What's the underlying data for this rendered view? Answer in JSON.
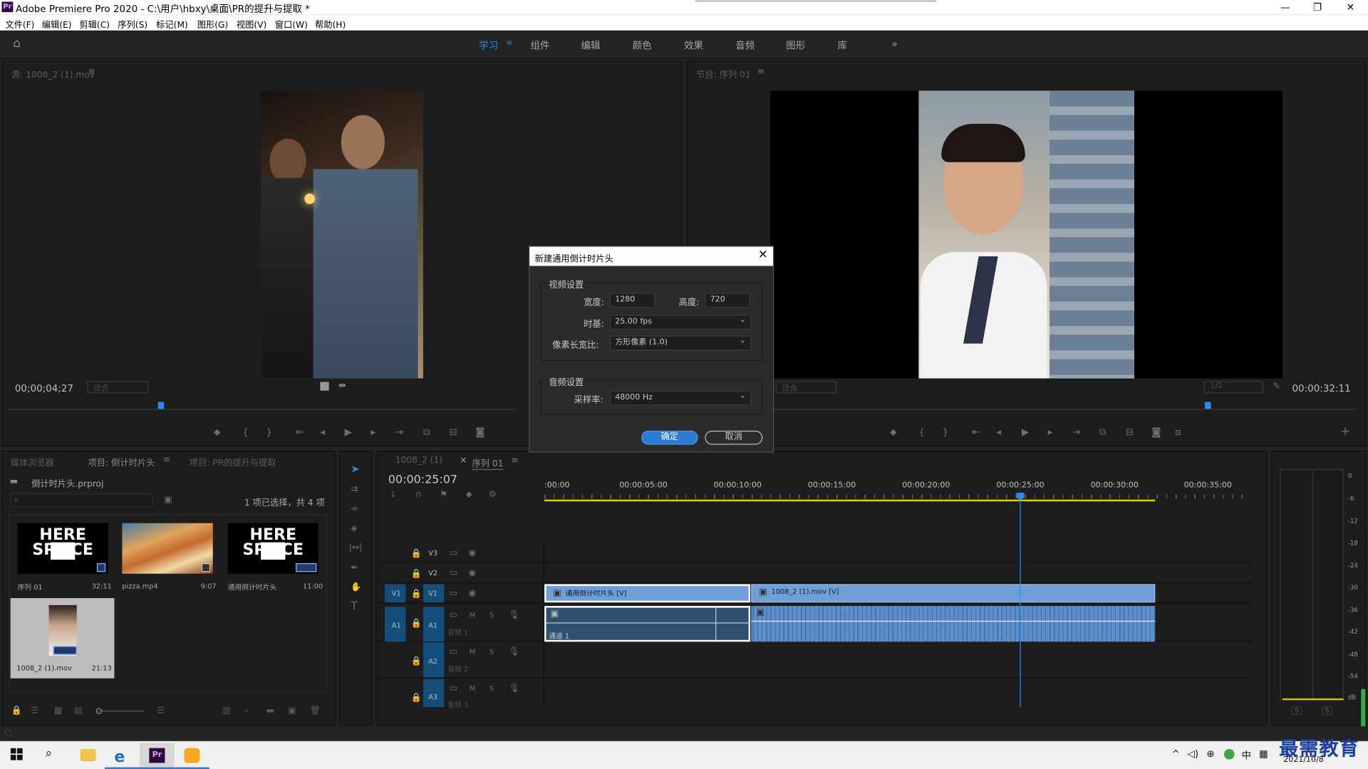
{
  "window": {
    "title": "Adobe Premiere Pro 2020 - C:\\用户\\hbxy\\桌面\\PR的提升与提取 *",
    "logo": "Pr"
  },
  "menu": [
    "文件(F)",
    "编辑(E)",
    "剪辑(C)",
    "序列(S)",
    "标记(M)",
    "图形(G)",
    "视图(V)",
    "窗口(W)",
    "帮助(H)"
  ],
  "workspaces": [
    "学习",
    "组件",
    "编辑",
    "颜色",
    "效果",
    "音频",
    "图形",
    "库"
  ],
  "source": {
    "title": "源: 1008_2 (1).mov",
    "timecode": "00;00;04;27",
    "fit": "适合"
  },
  "program": {
    "title": "节目: 序列 01",
    "timecode": "00:00:32:11",
    "fit": "适合",
    "scale": "1/2"
  },
  "dialog": {
    "title": "新建通用倒计时片头",
    "video_group": "视频设置",
    "width_label": "宽度:",
    "width_value": "1280",
    "height_label": "高度:",
    "height_value": "720",
    "timebase_label": "时基:",
    "timebase_value": "25.00 fps",
    "par_label": "像素长宽比:",
    "par_value": "方形像素 (1.0)",
    "audio_group": "音频设置",
    "rate_label": "采样率:",
    "rate_value": "48000 Hz",
    "ok": "确定",
    "cancel": "取消"
  },
  "project": {
    "tabs": [
      "媒体浏览器",
      "项目: 倒计时片头",
      "项目: PR的提升与提取"
    ],
    "file": "倒计时片头.prproj",
    "selection": "1 项已选择，共 4 项",
    "items": [
      {
        "name": "序列 01",
        "duration": "32:11"
      },
      {
        "name": "pizza.mp4",
        "duration": "9:07"
      },
      {
        "name": "通用倒计时片头",
        "duration": "11:00"
      },
      {
        "name": "1008_2 (1).mov",
        "duration": "21:13"
      }
    ],
    "splice_text": "HERE SPLICE"
  },
  "timeline": {
    "tabs": [
      "1008_2 (1)",
      "序列 01"
    ],
    "timecode": "00:00:25:07",
    "ruler": [
      ":00:00",
      "00:00:05:00",
      "00:00:10:00",
      "00:00:15:00",
      "00:00:20:00",
      "00:00:25:00",
      "00:00:30:00",
      "00:00:35:00"
    ],
    "tracks": {
      "v3": "V3",
      "v2": "V2",
      "v1": "V1",
      "a1": "A1",
      "a2": "A2",
      "a3": "A3",
      "src_v1": "V1",
      "src_a1": "A1"
    },
    "audio_names": [
      "音频 1",
      "音频 2",
      "音频 3"
    ],
    "clips": {
      "countdown_video": "通用倒计时片头 [V]",
      "mov_video": "1008_2 (1).mov [V]",
      "countdown_audio_label": "通道 1"
    }
  },
  "meter": {
    "scale": [
      "0",
      "-6",
      "-12",
      "-18",
      "-24",
      "-30",
      "-36",
      "-42",
      "-48",
      "-54",
      "dB"
    ],
    "channels": [
      "S",
      "S"
    ]
  },
  "taskbar": {
    "ime": "中",
    "date": "2021/10/8",
    "watermark": "最需教育"
  }
}
